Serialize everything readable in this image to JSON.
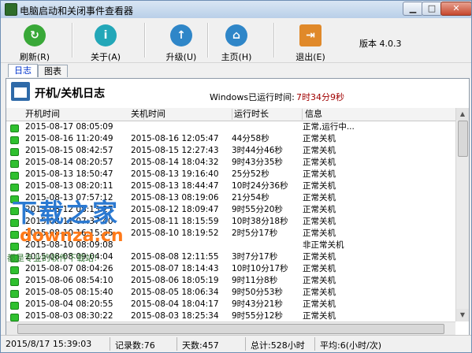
{
  "window": {
    "title": "电脑启动和关闭事件查看器"
  },
  "toolbar": {
    "buttons": [
      {
        "label": "刷新(R)"
      },
      {
        "label": "关于(A)"
      },
      {
        "label": "升级(U)"
      },
      {
        "label": "主页(H)"
      },
      {
        "label": "退出(E)"
      }
    ],
    "version": "版本 4.0.3"
  },
  "tabs": [
    {
      "label": "日志",
      "active": true
    },
    {
      "label": "图表",
      "active": false
    }
  ],
  "log": {
    "title": "开机/关机日志",
    "runtime_label": "Windows已运行时间:",
    "runtime_value": "7时34分9秒"
  },
  "table": {
    "columns": [
      "开机时间",
      "关机时间",
      "运行时长",
      "信息"
    ],
    "rows": [
      [
        "2015-08-17 08:05:09",
        "",
        "",
        "正常,运行中..."
      ],
      [
        "2015-08-16 11:20:49",
        "2015-08-16 12:05:47",
        "44分58秒",
        "正常关机"
      ],
      [
        "2015-08-15 08:42:57",
        "2015-08-15 12:27:43",
        "3时44分46秒",
        "正常关机"
      ],
      [
        "2015-08-14 08:20:57",
        "2015-08-14 18:04:32",
        "9时43分35秒",
        "正常关机"
      ],
      [
        "2015-08-13 18:50:47",
        "2015-08-13 19:16:40",
        "25分52秒",
        "正常关机"
      ],
      [
        "2015-08-13 08:20:11",
        "2015-08-13 18:44:47",
        "10时24分36秒",
        "正常关机"
      ],
      [
        "2015-08-13 07:57:12",
        "2015-08-13 08:19:06",
        "21分54秒",
        "正常关机"
      ],
      [
        "2015-08-12 08:13:27",
        "2015-08-12 18:09:47",
        "9时55分20秒",
        "正常关机"
      ],
      [
        "2015-08-11 07:37:40",
        "2015-08-11 18:15:59",
        "10时38分18秒",
        "正常关机"
      ],
      [
        "2015-08-10 16:15:35",
        "2015-08-10 18:19:52",
        "2时5分17秒",
        "正常关机"
      ],
      [
        "2015-08-10 08:09:08",
        "",
        "",
        "非正常关机"
      ],
      [
        "2015-08-08 09:04:04",
        "2015-08-08 12:11:55",
        "3时7分17秒",
        "正常关机"
      ],
      [
        "2015-08-07 08:04:26",
        "2015-08-07 18:14:43",
        "10时10分17秒",
        "正常关机"
      ],
      [
        "2015-08-06 08:54:10",
        "2015-08-06 18:05:19",
        "9时11分8秒",
        "正常关机"
      ],
      [
        "2015-08-05 08:15:40",
        "2015-08-05 18:06:34",
        "9时50分53秒",
        "正常关机"
      ],
      [
        "2015-08-04 08:20:55",
        "2015-08-04 18:04:17",
        "9时43分21秒",
        "正常关机"
      ],
      [
        "2015-08-03 08:30:22",
        "2015-08-03 18:25:34",
        "9时55分12秒",
        "正常关机"
      ]
    ]
  },
  "status": {
    "datetime": "2015/8/17 15:39:03",
    "records": "记录数:76",
    "days": "天数:457",
    "total": "总计:528小时",
    "average": "平均:6(小时/次)"
  },
  "watermark": {
    "line1": "下载之家",
    "line2": "downza.cn",
    "line3": "都是专业的软件下载站!"
  },
  "colors": {
    "accent_red": "#a00000",
    "status_green": "#2fc02f",
    "title_bar": "#c8daee"
  }
}
